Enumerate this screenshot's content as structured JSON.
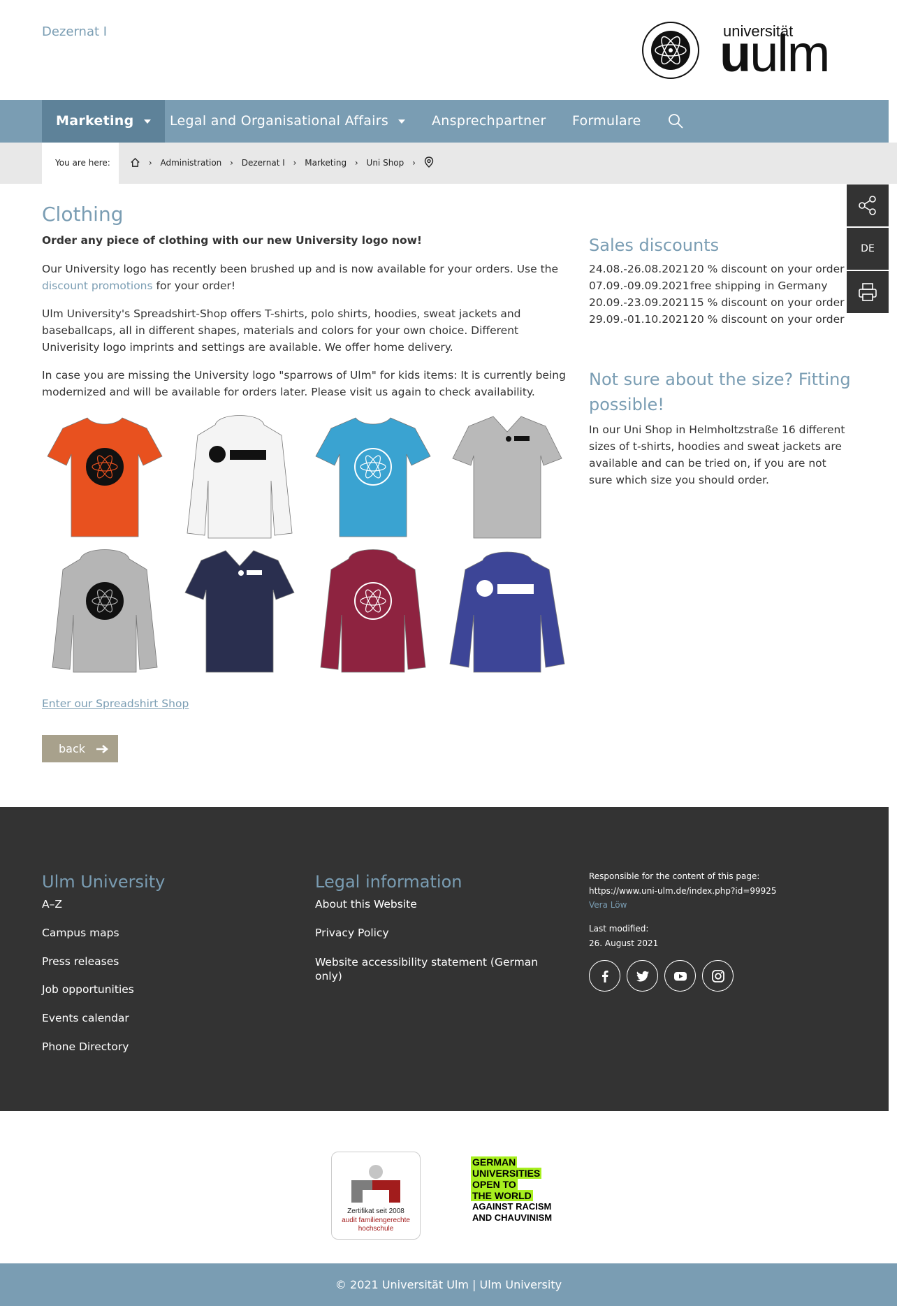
{
  "header": {
    "department": "Dezernat I",
    "logo_small": "universität",
    "logo_big_bold": "u",
    "logo_big": "ulm"
  },
  "nav": {
    "items": [
      "Marketing",
      "Legal and Organisational Affairs",
      "Ansprechpartner",
      "Formulare"
    ]
  },
  "breadcrumb": {
    "label": "You are here:",
    "items": [
      "Administration",
      "Dezernat I",
      "Marketing",
      "Uni Shop"
    ],
    "sep": "›"
  },
  "side_tools": {
    "lang": "DE"
  },
  "main": {
    "title": "Clothing",
    "lead": "Order any piece of clothing with our new University logo now!",
    "p1_before": "Our University logo has recently been brushed up and is now available for your orders. Use the ",
    "p1_link": "discount promotions",
    "p1_after": " for your order!",
    "p2": "Ulm University's Spreadshirt-Shop offers T-shirts, polo shirts, hoodies, sweat jackets and baseballcaps, all in different shapes, materials and colors for your own choice. Different Univerisity logo imprints and settings are available. We offer home delivery.",
    "p3": "In case you are missing the University logo \"sparrows of Ulm\" for kids items: It is currently being modernized and will be available for orders later. Please visit us again to check availability.",
    "shop_link": "Enter our Spreadshirt Shop",
    "back": "back",
    "products": [
      {
        "kind": "tshirt",
        "color": "#e8511f",
        "print": "seal-dark"
      },
      {
        "kind": "hoodie",
        "color": "#f4f4f4",
        "print": "logo-dark"
      },
      {
        "kind": "tshirt",
        "color": "#3aa3d1",
        "print": "seal-light"
      },
      {
        "kind": "polo",
        "color": "#b9b9b9",
        "print": "logo-small-dark"
      },
      {
        "kind": "hoodie",
        "color": "#b5b5b5",
        "print": "seal-dark"
      },
      {
        "kind": "polo",
        "color": "#2a2f4f",
        "print": "logo-small-light"
      },
      {
        "kind": "hoodie",
        "color": "#8e2340",
        "print": "seal-light"
      },
      {
        "kind": "jacket",
        "color": "#3d4597",
        "print": "logo-light"
      }
    ]
  },
  "sidebar": {
    "sales_title": "Sales discounts",
    "discounts": [
      {
        "date": "24.08.-26.08.2021",
        "text": "20 % discount on your order"
      },
      {
        "date": "07.09.-09.09.2021",
        "text": "free shipping in Germany"
      },
      {
        "date": "20.09.-23.09.2021",
        "text": "15 % discount on your order"
      },
      {
        "date": "29.09.-01.10.2021",
        "text": "20 % discount on your order"
      }
    ],
    "size_title_1": "Not sure about the size? Fitting",
    "size_title_2": "possible!",
    "size_text": "In our Uni Shop in Helmholtzstraße 16 different sizes of t-shirts, hoodies and sweat jackets are available and can be tried on, if you are not sure which size you should order."
  },
  "footer": {
    "col1_title": "Ulm University",
    "col1_links": [
      "A–Z",
      "Campus maps",
      "Press releases",
      "Job opportunities",
      "Events calendar",
      "Phone Directory"
    ],
    "col2_title": "Legal information",
    "col2_links": [
      "About this Website",
      "Privacy Policy",
      "Website accessibility statement (German only)"
    ],
    "responsible_label": "Responsible for the content of this page:",
    "responsible_url": "https://www.uni-ulm.de/index.php?id=99925",
    "responsible_person": "Vera Löw",
    "modified_label": "Last modified:",
    "modified_date": "26. August 2021",
    "social_icons": [
      "facebook-icon",
      "twitter-icon",
      "youtube-icon",
      "instagram-icon"
    ]
  },
  "badges": {
    "cert_line1": "Zertifikat seit 2008",
    "cert_line2": "audit familiengerechte hochschule",
    "guott_lines": [
      "GERMAN",
      "UNIVERSITIES",
      "OPEN TO",
      "THE WORLD"
    ],
    "guott_plain": [
      "AGAINST RACISM",
      "AND CHAUVINISM"
    ]
  },
  "copyright": "© 2021 Universität Ulm | Ulm University",
  "colors": {
    "accent": "#7a9db3",
    "dark": "#333333",
    "back_button": "#a8a18c"
  }
}
